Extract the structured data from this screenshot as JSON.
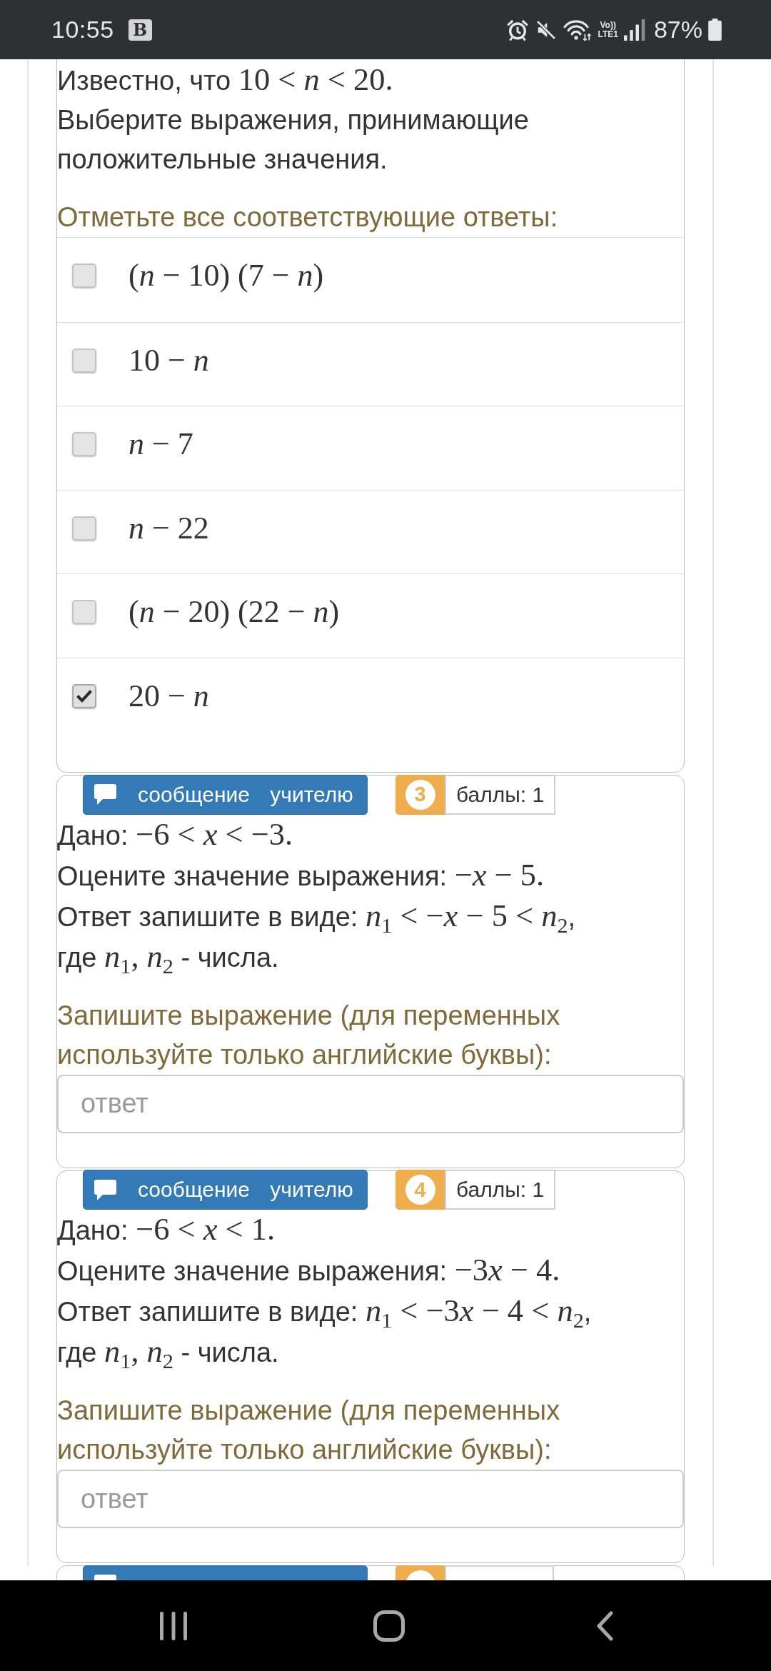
{
  "status_bar": {
    "time": "10:55",
    "app_badge": "B",
    "network_labels": [
      "Vo))",
      "LTE1"
    ],
    "battery": "87%"
  },
  "questions": [
    {
      "kind": "checkboxes",
      "lines": [
        [
          {
            "kind": "text",
            "text": "Известно, что "
          },
          {
            "kind": "math",
            "text": "10 < *n* < 20."
          }
        ],
        [
          {
            "kind": "text",
            "text": "Выберите выражения, принимающие положительные значения."
          }
        ]
      ],
      "prompt": "Отметьте все соответствующие ответы:",
      "options": [
        {
          "label": "(*n* − 10) (7 − *n*)",
          "checked": false
        },
        {
          "label": "10 − *n*",
          "checked": false
        },
        {
          "label": "*n* − 7",
          "checked": false
        },
        {
          "label": "*n* − 22",
          "checked": false
        },
        {
          "label": "(*n* − 20) (22 − *n*)",
          "checked": false
        },
        {
          "label": "20 − *n*",
          "checked": true
        }
      ]
    },
    {
      "kind": "text_answer",
      "header": {
        "kind": "message_bar",
        "button": "сообщение учителю",
        "number": "3",
        "points": "баллы: 1"
      },
      "lines": [
        [
          {
            "kind": "text",
            "text": "Дано: "
          },
          {
            "kind": "math",
            "text": "−6 < *x* < −3."
          }
        ],
        [
          {
            "kind": "text",
            "text": "Оцените значение выражения: "
          },
          {
            "kind": "math",
            "text": "−*x* − 5."
          }
        ],
        [
          {
            "kind": "text",
            "text": "Ответ запишите в виде: "
          },
          {
            "kind": "math",
            "text": "*n*$_{1}$ < −*x* − 5 < *n*$_{2}$"
          },
          {
            "kind": "text",
            "text": ","
          }
        ],
        [
          {
            "kind": "text",
            "text": "где "
          },
          {
            "kind": "math",
            "text": "*n*$_{1}$, *n*$_{2}$"
          },
          {
            "kind": "text",
            "text": " - числа."
          }
        ]
      ],
      "prompt": "Запишите выражение (для переменных используйте только английские буквы):",
      "placeholder": "ответ"
    },
    {
      "kind": "text_answer",
      "header": {
        "kind": "message_bar",
        "button": "сообщение учителю",
        "number": "4",
        "points": "баллы: 1"
      },
      "lines": [
        [
          {
            "kind": "text",
            "text": "Дано: "
          },
          {
            "kind": "math",
            "text": "−6 < *x* < 1."
          }
        ],
        [
          {
            "kind": "text",
            "text": "Оцените значение выражения: "
          },
          {
            "kind": "math",
            "text": "−3"
          },
          {
            "kind": "math",
            "text": "*x* − 4."
          }
        ],
        [
          {
            "kind": "text",
            "text": "Ответ запишите в виде: "
          },
          {
            "kind": "math",
            "text": "*n*$_{1}$ < −3"
          },
          {
            "kind": "math",
            "text": "*x* − 4 < *n*$_{2}$"
          },
          {
            "kind": "text",
            "text": ","
          }
        ],
        [
          {
            "kind": "text",
            "text": "где "
          },
          {
            "kind": "math",
            "text": "*n*$_{1}$, *n*$_{2}$"
          },
          {
            "kind": "text",
            "text": " - числа."
          }
        ]
      ],
      "prompt": "Запишите выражение (для переменных используйте только английские буквы):",
      "placeholder": "ответ"
    },
    {
      "header": {
        "kind": "message_bar"
      }
    }
  ]
}
